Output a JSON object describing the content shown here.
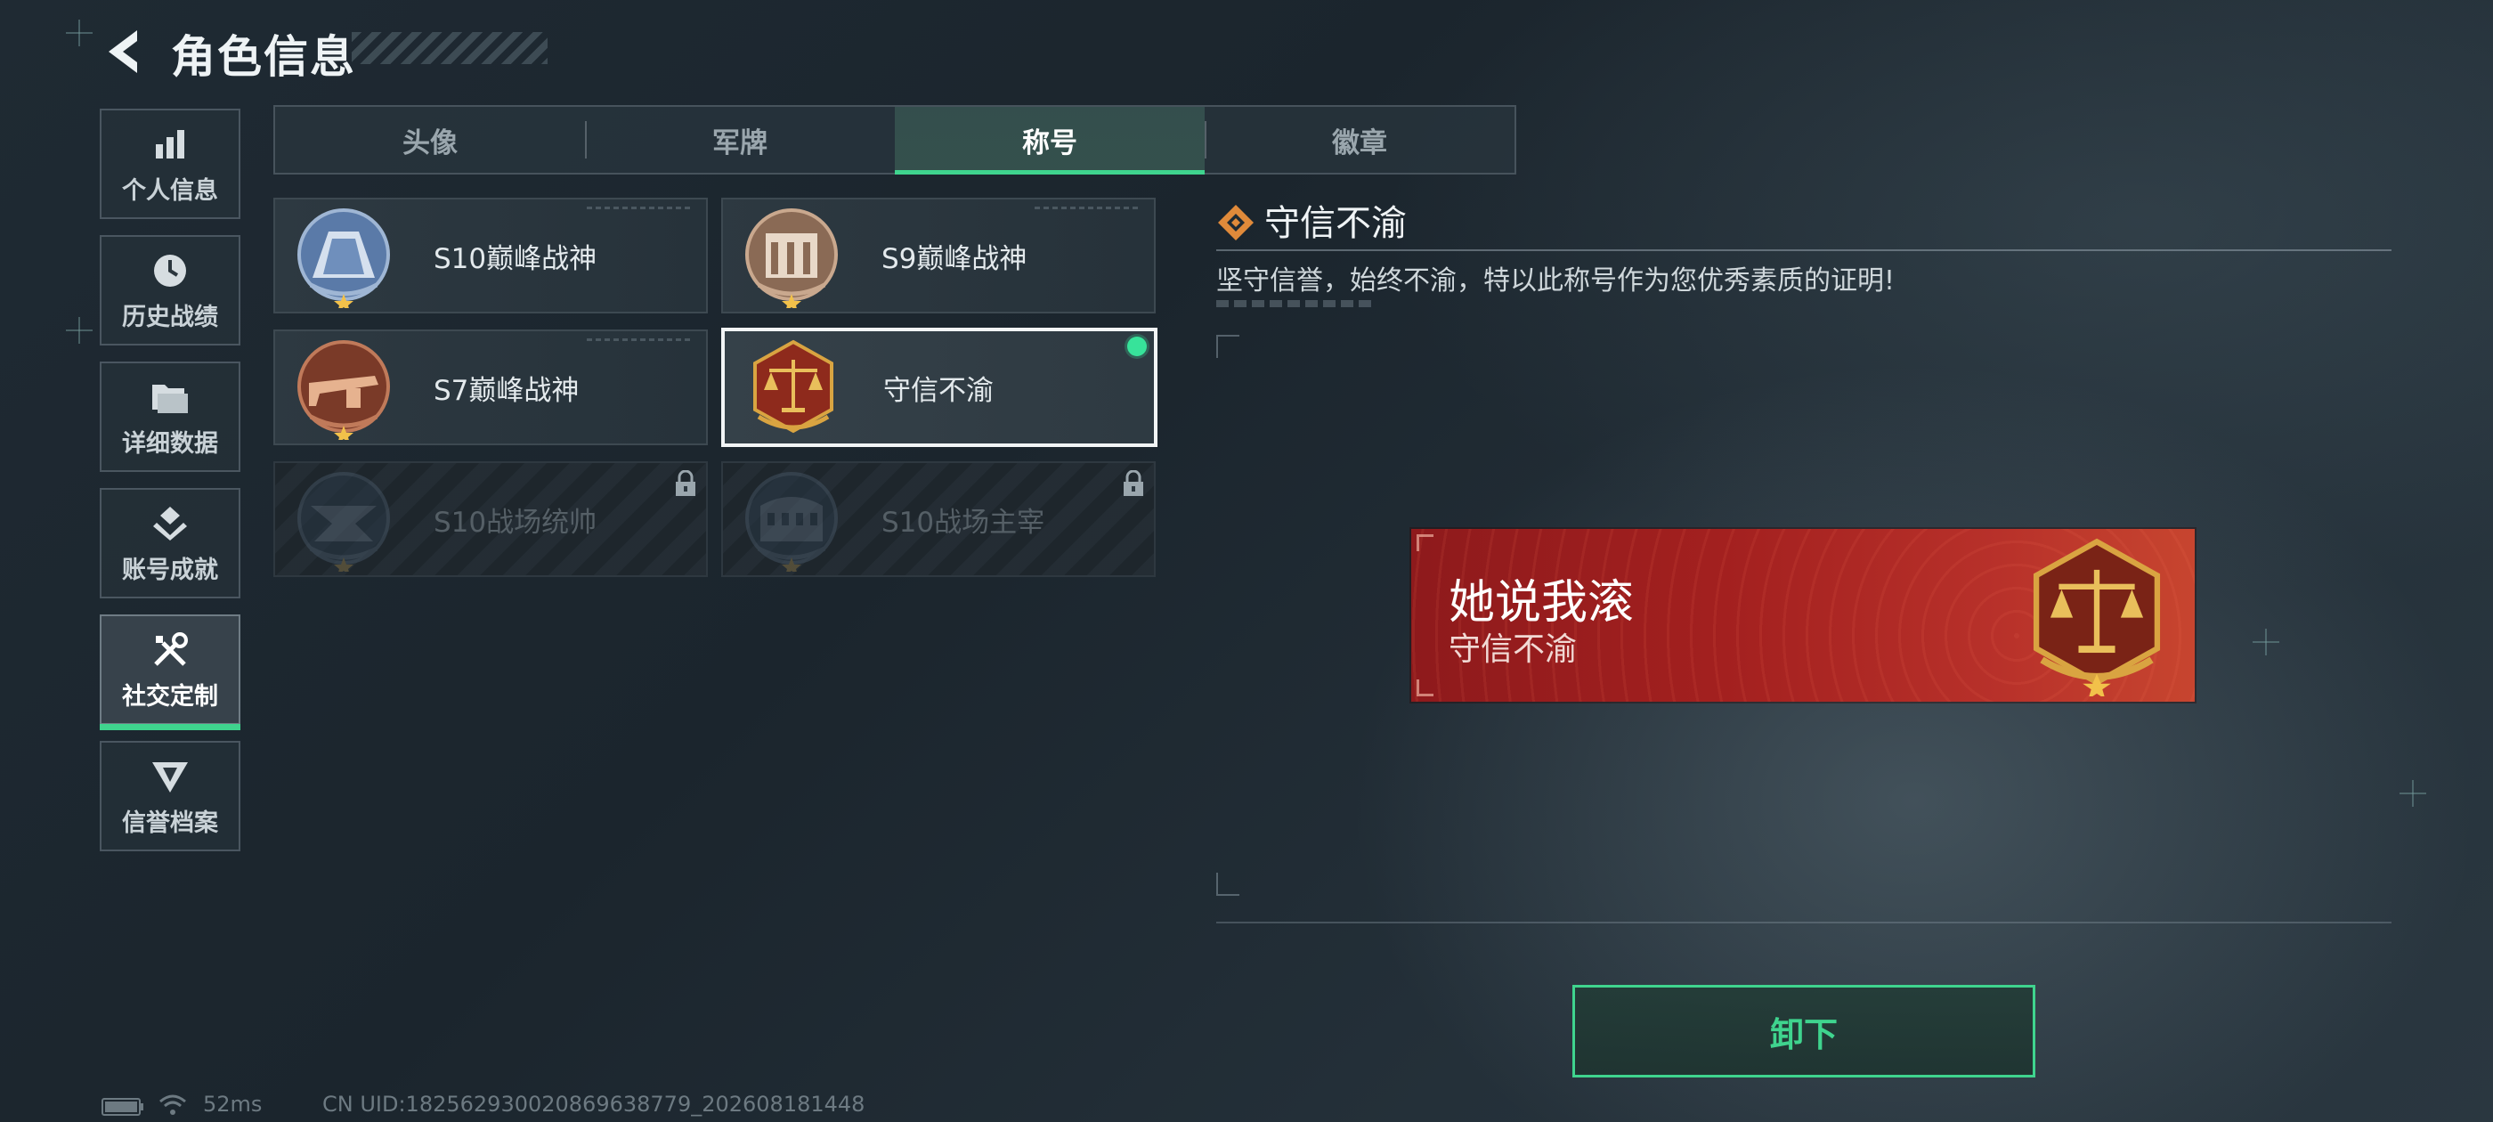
{
  "header": {
    "title": "角色信息"
  },
  "sidebar": {
    "items": [
      {
        "label": "个人信息",
        "icon": "bar-chart-icon",
        "active": false
      },
      {
        "label": "历史战绩",
        "icon": "clock-icon",
        "active": false
      },
      {
        "label": "详细数据",
        "icon": "folder-icon",
        "active": false
      },
      {
        "label": "账号成就",
        "icon": "achievement-icon",
        "active": false
      },
      {
        "label": "社交定制",
        "icon": "tools-icon",
        "active": true
      },
      {
        "label": "信誉档案",
        "icon": "reputation-icon",
        "active": false
      }
    ]
  },
  "tabs": [
    {
      "label": "头像",
      "active": false
    },
    {
      "label": "军牌",
      "active": false
    },
    {
      "label": "称号",
      "active": true
    },
    {
      "label": "徽章",
      "active": false
    }
  ],
  "titles": [
    {
      "label": "S10巅峰战神",
      "state": "unlocked",
      "icon": "s10-emblem-icon"
    },
    {
      "label": "S9巅峰战神",
      "state": "unlocked",
      "icon": "s9-emblem-icon"
    },
    {
      "label": "S7巅峰战神",
      "state": "unlocked",
      "icon": "s7-emblem-icon"
    },
    {
      "label": "守信不渝",
      "state": "selected-equipped",
      "icon": "scales-emblem-icon"
    },
    {
      "label": "S10战场统帅",
      "state": "locked",
      "icon": "commander-emblem-icon"
    },
    {
      "label": "S10战场主宰",
      "state": "locked",
      "icon": "colosseum-emblem-icon"
    }
  ],
  "detail": {
    "title": "守信不渝",
    "description": "坚守信誉，始终不渝，特以此称号作为您优秀素质的证明!"
  },
  "nameplate": {
    "player_name": "她说我滚",
    "title": "守信不渝"
  },
  "actions": {
    "unequip_label": "卸下"
  },
  "status": {
    "ping": "52ms",
    "uid": "CN UID:182562930020869638779_202608181448"
  },
  "colors": {
    "accent_green": "#3fd48e",
    "equipped_dot": "#37e39a",
    "plate_red": "#a3201f",
    "emblem_gold": "#d9a441"
  }
}
